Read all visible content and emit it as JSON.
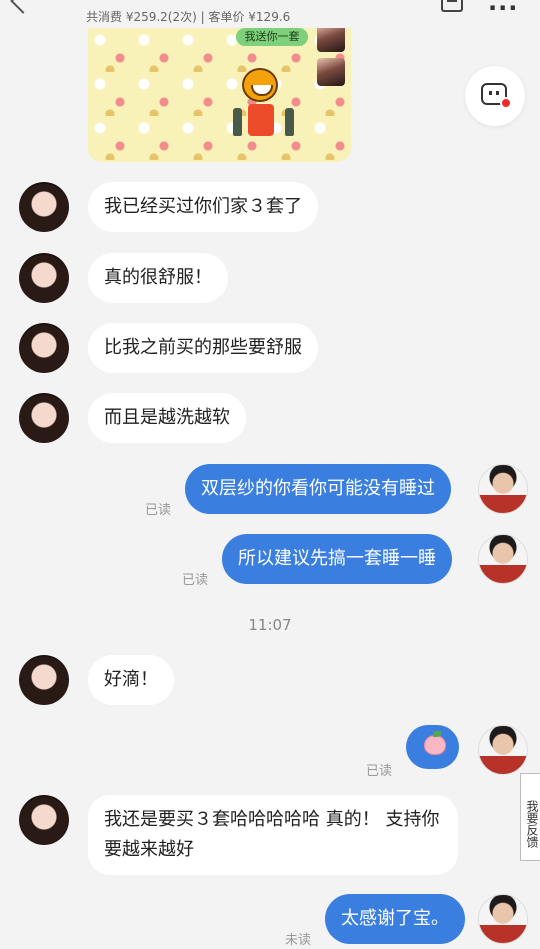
{
  "header": {
    "stats": "共消费 ¥259.2(2次) | 客单价 ¥129.6",
    "sticker_button": "我送你一套"
  },
  "messages": [
    {
      "from": "customer",
      "text": "我已经买过你们家３套了"
    },
    {
      "from": "customer",
      "text": "真的很舒服！"
    },
    {
      "from": "customer",
      "text": "比我之前买的那些要舒服"
    },
    {
      "from": "customer",
      "text": "而且是越洗越软"
    },
    {
      "from": "agent",
      "text": "双层纱的你看你可能没有睡过",
      "status": "已读"
    },
    {
      "from": "agent",
      "text": "所以建议先搞一套睡一睡",
      "status": "已读"
    },
    {
      "from": "customer",
      "text": "好滴！"
    },
    {
      "from": "agent",
      "emoji": "peach-sticker",
      "status": "已读"
    },
    {
      "from": "customer",
      "line1": "我还是要买３套哈哈哈哈哈 真的！ 支持你",
      "line2": "要越来越好"
    },
    {
      "from": "agent",
      "text": "太感谢了宝。",
      "status": "未读"
    }
  ],
  "time_divider": "11:07",
  "feedback_tab": "我要反馈",
  "icons": [
    "back-arrow-icon",
    "note-icon",
    "more-icon",
    "robot-icon",
    "peach-icon"
  ],
  "colors": {
    "background": "#f3f3f3",
    "agent_bubble": "#3a7fe0",
    "customer_bubble": "#ffffff",
    "notification_dot": "#ee2a2a"
  }
}
